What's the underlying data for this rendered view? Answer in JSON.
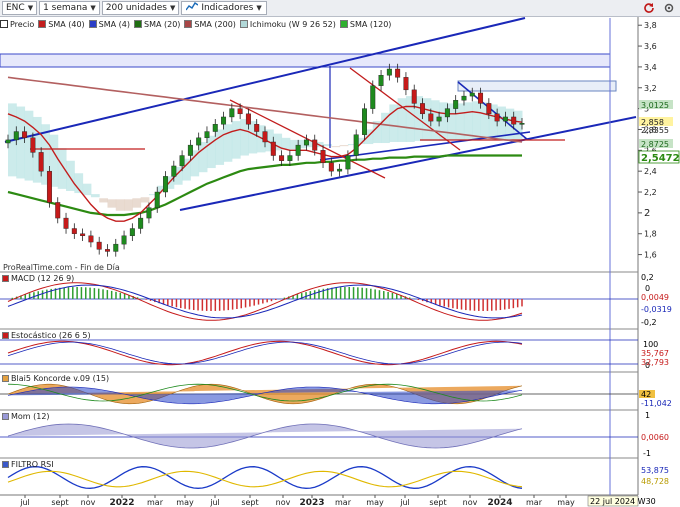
{
  "toolbar": {
    "ticker": "ENC",
    "period": "1 semana",
    "units": "200 unidades",
    "indicators_label": "Indicadores"
  },
  "legend": [
    "Precio",
    "SMA (40)",
    "SMA (4)",
    "SMA (20)",
    "SMA (200)",
    "Ichimoku (W 9 26 52)",
    "SMA (120)"
  ],
  "watermark": "ProRealTime.com - Fin de Día",
  "colors": {
    "up": "#1e8a1e",
    "down": "#c61a1a",
    "channel": "#1a28b8",
    "sma40": "#c21d1d",
    "sma20": "#2c8a12",
    "sma200": "#b36060",
    "cloud_bull": "#bfe6e6",
    "cloud_bear": "#e3d2c6"
  },
  "panels": {
    "macd": "MACD (12 26 9)",
    "stochastic": "Estocástico (26 6 5)",
    "koncorde": "Blai5 Koncorde v.09 (15)",
    "momentum": "Mom (12)",
    "rsi": "FILTRO RSI"
  },
  "chart_data": {
    "type": "line",
    "title": "",
    "instrument": "ENC",
    "x_ticks": [
      "jul",
      "sept",
      "nov",
      "2022",
      "mar",
      "may",
      "jul",
      "sept",
      "nov",
      "2023",
      "mar",
      "may",
      "jul",
      "sept",
      "nov",
      "2024",
      "mar",
      "may"
    ],
    "cursor_label": "22 jul 2024 W30",
    "y_ticks": [
      "3,8",
      "3,6",
      "3,4",
      "3,2",
      "3",
      "2,8",
      "2,6",
      "2,4",
      "2,2",
      "2",
      "1,8",
      "1,6"
    ],
    "price_labels": {
      "last_high": "3,0125",
      "close": "2,858",
      "low": "2,8355",
      "sma40": "2,8725",
      "sma200": "2,5472"
    },
    "price_series": {
      "name": "Precio",
      "close": [
        2.7,
        2.78,
        2.72,
        2.58,
        2.4,
        2.1,
        1.95,
        1.85,
        1.8,
        1.78,
        1.72,
        1.65,
        1.63,
        1.7,
        1.78,
        1.85,
        1.95,
        2.05,
        2.2,
        2.35,
        2.45,
        2.55,
        2.65,
        2.72,
        2.78,
        2.85,
        2.92,
        3.0,
        2.95,
        2.85,
        2.78,
        2.68,
        2.55,
        2.5,
        2.55,
        2.65,
        2.7,
        2.6,
        2.48,
        2.4,
        2.42,
        2.55,
        2.75,
        3.0,
        3.22,
        3.32,
        3.38,
        3.3,
        3.18,
        3.05,
        2.95,
        2.88,
        2.92,
        3.0,
        3.08,
        3.12,
        3.15,
        3.05,
        2.95,
        2.88,
        2.92,
        2.85,
        2.86
      ]
    },
    "sma40_series": [
      2.95,
      2.92,
      2.88,
      2.82,
      2.75,
      2.65,
      2.52,
      2.4,
      2.28,
      2.18,
      2.08,
      2.0,
      1.95,
      1.92,
      1.92,
      1.95,
      2.0,
      2.08,
      2.16,
      2.25,
      2.34,
      2.42,
      2.5,
      2.58,
      2.64,
      2.7,
      2.75,
      2.78,
      2.8,
      2.78,
      2.74,
      2.7,
      2.66,
      2.62,
      2.6,
      2.6,
      2.6,
      2.58,
      2.56,
      2.54,
      2.54,
      2.56,
      2.62,
      2.7,
      2.78,
      2.86,
      2.94,
      3.0,
      3.02,
      3.02,
      3.0,
      2.98,
      2.96,
      2.95,
      2.95,
      2.96,
      2.97,
      2.96,
      2.94,
      2.92,
      2.9,
      2.88,
      2.87
    ],
    "sma200_series": [
      3.3,
      3.29,
      3.28,
      3.27,
      3.26,
      3.25,
      3.24,
      3.23,
      3.22,
      3.21,
      3.2,
      3.19,
      3.18,
      3.17,
      3.16,
      3.15,
      3.14,
      3.13,
      3.12,
      3.11,
      3.1,
      3.09,
      3.08,
      3.07,
      3.06,
      3.05,
      3.04,
      3.03,
      3.02,
      3.01,
      3.0,
      2.99,
      2.98,
      2.97,
      2.96,
      2.95,
      2.94,
      2.93,
      2.92,
      2.91,
      2.9,
      2.89,
      2.88,
      2.87,
      2.86,
      2.85,
      2.84,
      2.83,
      2.82,
      2.81,
      2.8,
      2.79,
      2.78,
      2.77,
      2.76,
      2.75,
      2.74,
      2.73,
      2.72,
      2.71,
      2.7,
      2.69,
      2.68
    ],
    "sma120_series": [
      2.2,
      2.18,
      2.16,
      2.14,
      2.12,
      2.1,
      2.08,
      2.06,
      2.04,
      2.02,
      2.0,
      1.99,
      1.98,
      1.98,
      1.98,
      1.99,
      2.0,
      2.02,
      2.05,
      2.08,
      2.12,
      2.16,
      2.2,
      2.24,
      2.28,
      2.31,
      2.34,
      2.37,
      2.4,
      2.42,
      2.43,
      2.44,
      2.45,
      2.46,
      2.46,
      2.47,
      2.48,
      2.48,
      2.49,
      2.49,
      2.5,
      2.5,
      2.51,
      2.51,
      2.52,
      2.52,
      2.53,
      2.53,
      2.53,
      2.54,
      2.54,
      2.54,
      2.54,
      2.55,
      2.55,
      2.55,
      2.55,
      2.55,
      2.55,
      2.55,
      2.55,
      2.55,
      2.55
    ],
    "ylim": [
      1.5,
      3.85
    ],
    "grid": false,
    "indicator_labels": {
      "macd": [
        "0,2",
        "0",
        "-0,2",
        "0,0049",
        "-0,0319"
      ],
      "stochastic": [
        "100",
        "0",
        "35,767",
        "32,793"
      ],
      "koncorde": [
        "42",
        "-11,042"
      ],
      "momentum": [
        "1",
        "0,0060",
        "-1"
      ],
      "rsi": [
        "53,875",
        "48,728"
      ]
    }
  }
}
